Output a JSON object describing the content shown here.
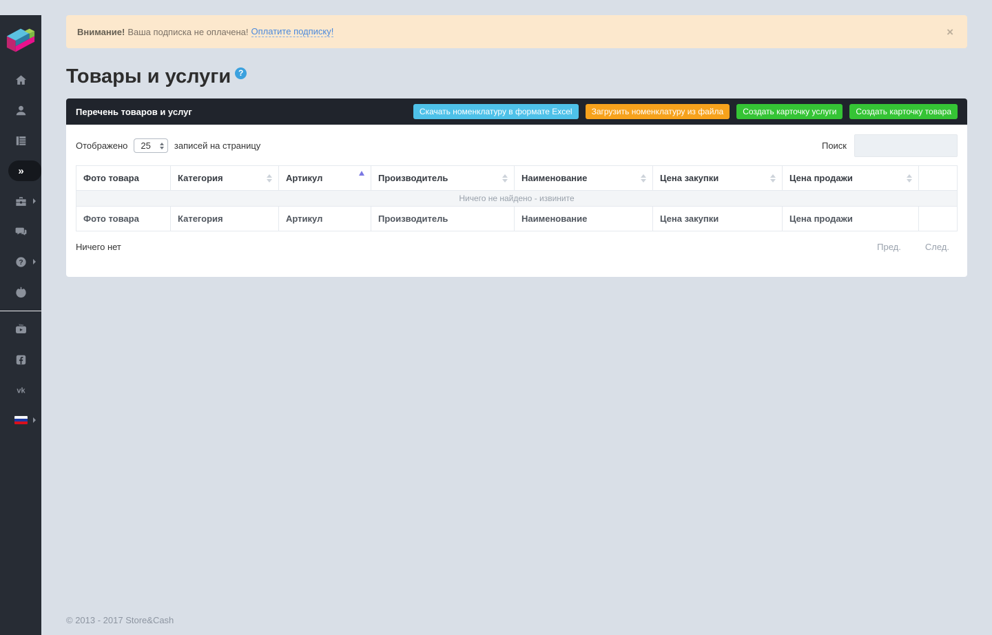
{
  "app": {
    "logo_icon": "storecash-cube-logo",
    "brand_colors": {
      "light_blue": "#5bc1e0",
      "teal": "#2d7aa2",
      "green": "#7db843",
      "magenta": "#e8118c"
    }
  },
  "sidebar": {
    "icons": [
      "home-icon",
      "user-icon",
      "catalog-table-icon",
      "collapse-chevrons-icon",
      "briefcase-icon",
      "chat-icon",
      "help-icon",
      "power-icon",
      "youtube-icon",
      "facebook-icon",
      "vk-icon",
      "flag-ru-icon"
    ]
  },
  "banner": {
    "bold": "Внимание!",
    "text": "Ваша подписка не оплачена!",
    "link": "Оплатите подписку!",
    "close_icon": "×"
  },
  "page": {
    "title": "Товары и услуги",
    "help_icon": "?"
  },
  "panel": {
    "header": "Перечень товаров и услуг",
    "buttons": [
      {
        "label": "Скачать номенклатуру в формате Excel",
        "color": "#4ec1e9"
      },
      {
        "label": "Загрузить номенклатуру из файла",
        "color": "#f7a21c"
      },
      {
        "label": "Создать карточку услуги",
        "color": "#35c435"
      },
      {
        "label": "Создать карточку товара",
        "color": "#35c435"
      }
    ],
    "page_size": {
      "prefix": "Отображено",
      "value": "25",
      "suffix": "записей на страницу"
    },
    "search_label": "Поиск",
    "table": {
      "columns": [
        {
          "label": "Фото товара",
          "sort": "none"
        },
        {
          "label": "Категория",
          "sort": "both"
        },
        {
          "label": "Артикул",
          "sort": "asc"
        },
        {
          "label": "Производитель",
          "sort": "both"
        },
        {
          "label": "Наименование",
          "sort": "both"
        },
        {
          "label": "Цена закупки",
          "sort": "both"
        },
        {
          "label": "Цена продажи",
          "sort": "both"
        },
        {
          "label": "",
          "sort": "none"
        }
      ],
      "empty_message": "Ничего не найдено - извините"
    },
    "status": "Ничего нет",
    "pagination": {
      "prev": "Пред.",
      "next": "След."
    },
    "active_glyph": "»"
  },
  "footer": {
    "copyright": "© 2013 - 2017 Store&Cash"
  }
}
